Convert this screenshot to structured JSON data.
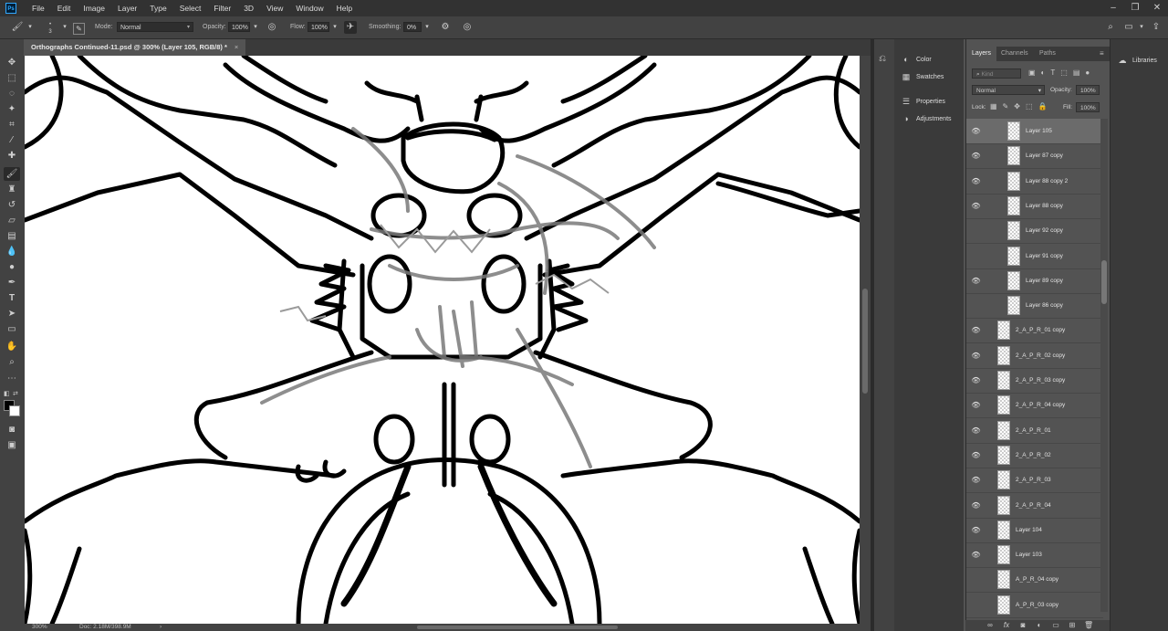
{
  "app": {
    "logo": "Ps"
  },
  "menu": [
    "File",
    "Edit",
    "Image",
    "Layer",
    "Type",
    "Select",
    "Filter",
    "3D",
    "View",
    "Window",
    "Help"
  ],
  "options_bar": {
    "brush_size": "3",
    "mode_label": "Mode:",
    "mode_value": "Normal",
    "opacity_label": "Opacity:",
    "opacity_value": "100%",
    "flow_label": "Flow:",
    "flow_value": "100%",
    "smoothing_label": "Smoothing:",
    "smoothing_value": "0%"
  },
  "document": {
    "tab_title": "Orthographs Continued-11.psd @ 300% (Layer 105, RGB/8) *",
    "close_glyph": "×",
    "zoom": "300%",
    "doc_info": "Doc: 2.18M/398.9M"
  },
  "dock_panels": [
    {
      "label": "Color",
      "icon": "color-icon"
    },
    {
      "label": "Swatches",
      "icon": "swatches-icon"
    },
    {
      "label": "Properties",
      "icon": "properties-icon"
    },
    {
      "label": "Adjustments",
      "icon": "adjustments-icon"
    }
  ],
  "layers_panel": {
    "tabs": [
      "Layers",
      "Channels",
      "Paths"
    ],
    "active_tab": "Layers",
    "filter_placeholder": "Kind",
    "blend_mode": "Normal",
    "opacity_label": "Opacity:",
    "opacity_value": "100%",
    "lock_label": "Lock:",
    "fill_label": "Fill:",
    "fill_value": "100%",
    "layers": [
      {
        "name": "Layer 105",
        "visible": true,
        "selected": true
      },
      {
        "name": "Layer 87 copy",
        "visible": true,
        "selected": false
      },
      {
        "name": "Layer 88 copy 2",
        "visible": true,
        "selected": false
      },
      {
        "name": "Layer 88 copy",
        "visible": true,
        "selected": false
      },
      {
        "name": "Layer 92 copy",
        "visible": false,
        "selected": false
      },
      {
        "name": "Layer 91 copy",
        "visible": false,
        "selected": false
      },
      {
        "name": "Layer 89 copy",
        "visible": true,
        "selected": false
      },
      {
        "name": "Layer 86 copy",
        "visible": false,
        "selected": false
      },
      {
        "name": "2_A_P_R_01 copy",
        "visible": true,
        "selected": false
      },
      {
        "name": "2_A_P_R_02 copy",
        "visible": true,
        "selected": false
      },
      {
        "name": "2_A_P_R_03 copy",
        "visible": true,
        "selected": false
      },
      {
        "name": "2_A_P_R_04 copy",
        "visible": true,
        "selected": false
      },
      {
        "name": "2_A_P_R_01",
        "visible": true,
        "selected": false
      },
      {
        "name": "2_A_P_R_02",
        "visible": true,
        "selected": false
      },
      {
        "name": "2_A_P_R_03",
        "visible": true,
        "selected": false
      },
      {
        "name": "2_A_P_R_04",
        "visible": true,
        "selected": false
      },
      {
        "name": "Layer 104",
        "visible": true,
        "selected": false
      },
      {
        "name": "Layer 103",
        "visible": true,
        "selected": false
      },
      {
        "name": "A_P_R_04 copy",
        "visible": false,
        "selected": false
      },
      {
        "name": "A_P_R_03 copy",
        "visible": false,
        "selected": false
      }
    ]
  },
  "libraries": {
    "label": "Libraries"
  },
  "colors": {
    "foreground": "#000000",
    "background": "#ffffff"
  }
}
